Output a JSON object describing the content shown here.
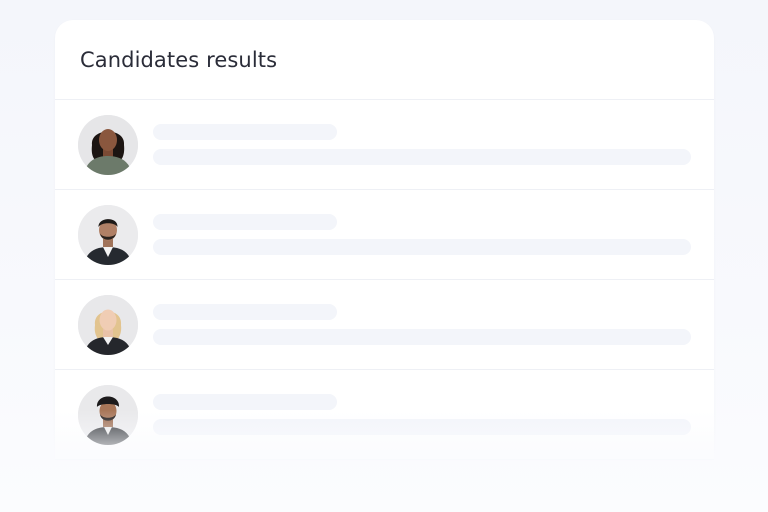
{
  "card": {
    "title": "Candidates results"
  },
  "candidates": [
    {
      "avatar_icon": "person-photo-icon"
    },
    {
      "avatar_icon": "person-photo-icon"
    },
    {
      "avatar_icon": "person-photo-icon"
    },
    {
      "avatar_icon": "person-photo-icon"
    }
  ],
  "colors": {
    "skeleton": "#f3f5fa",
    "title": "#2a2c38",
    "divider": "#eef0f5"
  }
}
